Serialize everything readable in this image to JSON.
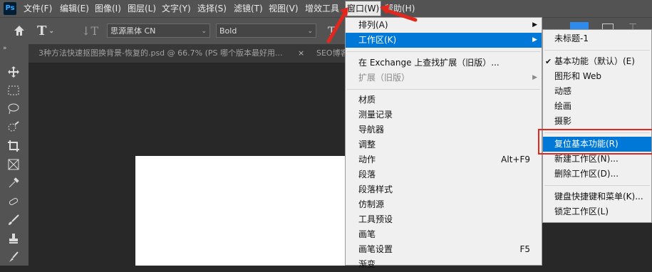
{
  "app": {
    "logo_text": "Ps"
  },
  "menubar": {
    "items": [
      "文件(F)",
      "编辑(E)",
      "图像(I)",
      "图层(L)",
      "文字(Y)",
      "选择(S)",
      "滤镜(T)",
      "视图(V)",
      "增效工具",
      "窗口(W)",
      "帮助(H)"
    ],
    "active_index": 9
  },
  "optionsbar": {
    "font_family": "思源黑体 CN",
    "font_style": "Bold"
  },
  "panel_collapse_label": "»",
  "tabs": [
    {
      "label": "3种方法快速抠图换背景-恢复的.psd @ 66.7% (PS 哪个版本最好用...",
      "close": "×"
    },
    {
      "label": "SEO博客",
      "close": ""
    }
  ],
  "window_menu": {
    "items": [
      {
        "label": "排列(A)",
        "submenu": true
      },
      {
        "label": "工作区(K)",
        "submenu": true,
        "highlight": true
      },
      {
        "label": "在 Exchange 上查找扩展（旧版）..."
      },
      {
        "label": "扩展（旧版）",
        "submenu": true,
        "disabled": true
      },
      {
        "label": "材质"
      },
      {
        "label": "测量记录"
      },
      {
        "label": "导航器"
      },
      {
        "label": "调整"
      },
      {
        "label": "动作",
        "shortcut": "Alt+F9"
      },
      {
        "label": "段落"
      },
      {
        "label": "段落样式"
      },
      {
        "label": "仿制源"
      },
      {
        "label": "工具预设"
      },
      {
        "label": "画笔"
      },
      {
        "label": "画笔设置",
        "shortcut": "F5"
      },
      {
        "label": "渐变"
      }
    ]
  },
  "workspace_submenu": {
    "items": [
      {
        "label": "未标题-1"
      },
      {
        "label": "基本功能（默认）(E)",
        "checked": true
      },
      {
        "label": "图形和 Web"
      },
      {
        "label": "动感"
      },
      {
        "label": "绘画"
      },
      {
        "label": "摄影"
      },
      {
        "label": "复位基本功能(R)",
        "highlight": true
      },
      {
        "label": "新建工作区(N)..."
      },
      {
        "label": "删除工作区(D)..."
      },
      {
        "label": "键盘快捷键和菜单(K)..."
      },
      {
        "label": "锁定工作区(L)"
      }
    ]
  },
  "colors": {
    "highlight": "#0078d7",
    "annotation": "#e0281e",
    "menubar": "#535353",
    "canvas_bg": "#282828"
  }
}
